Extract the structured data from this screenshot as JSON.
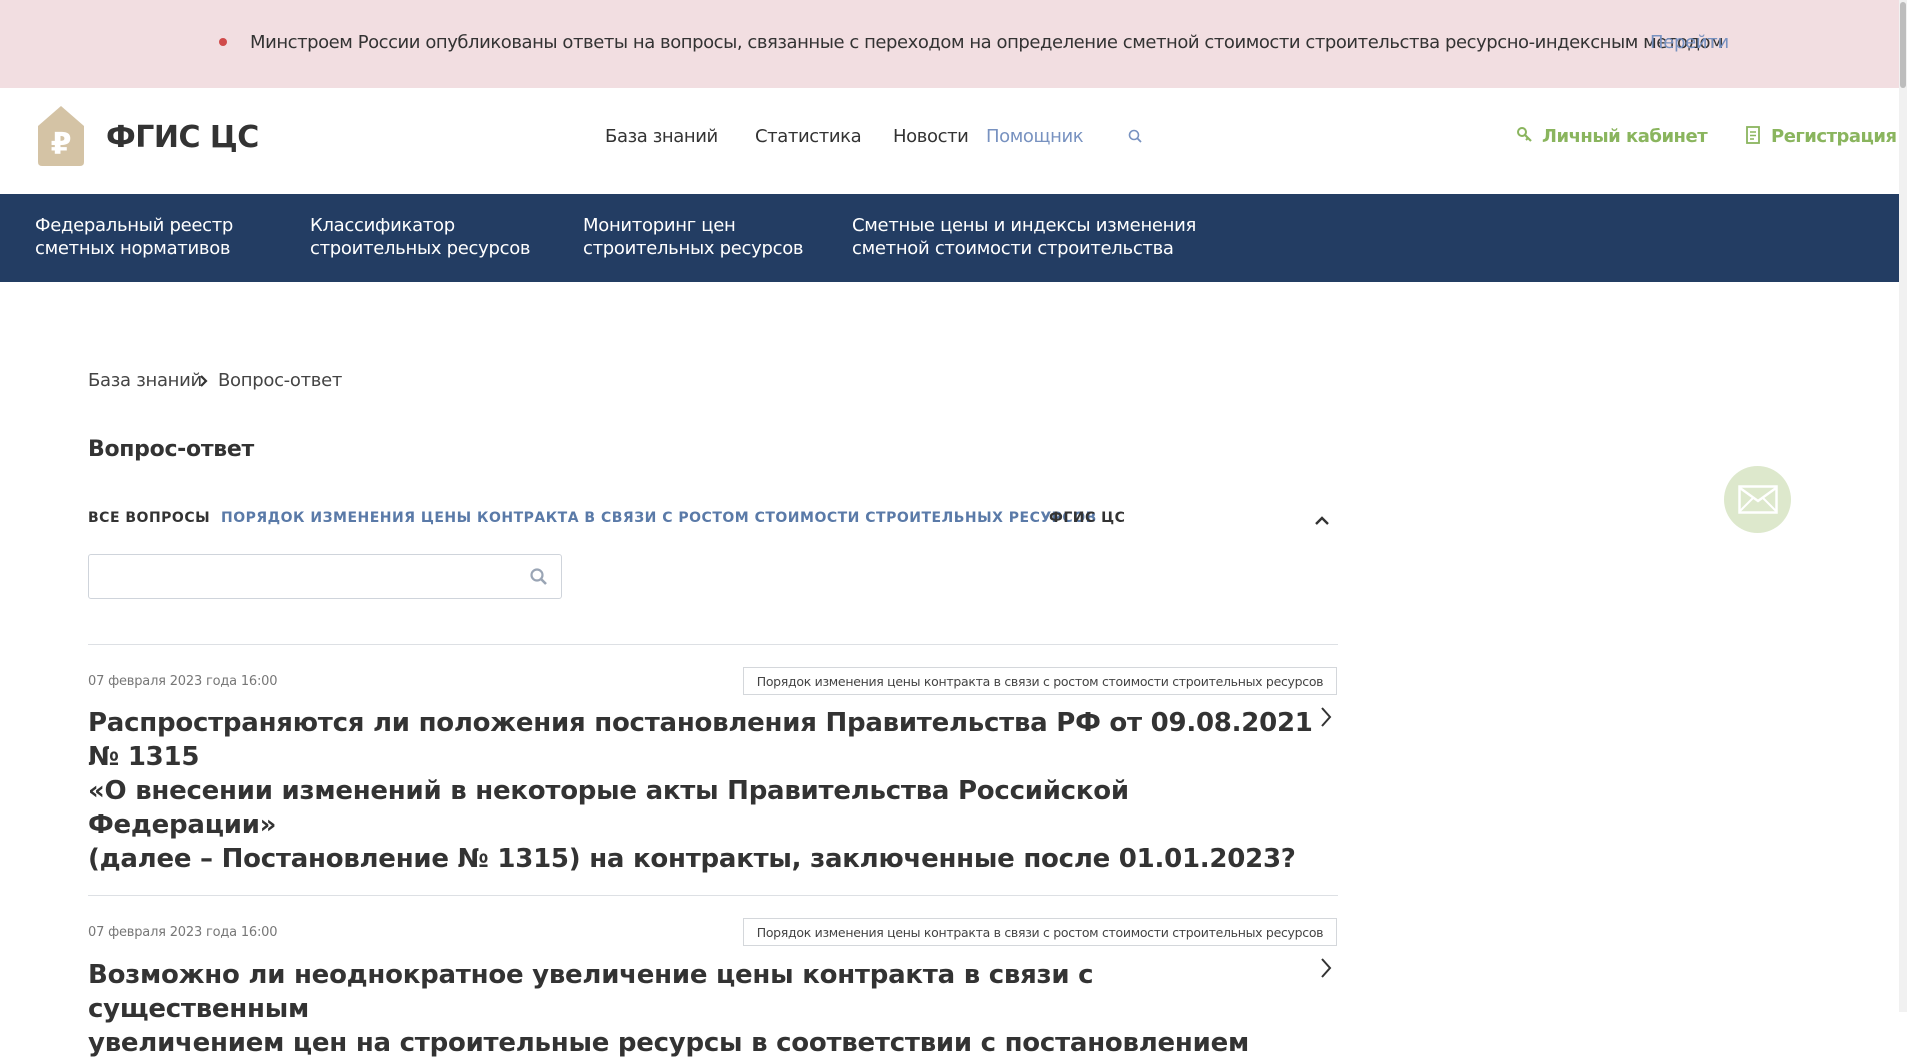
{
  "announcement": {
    "text": "Минстроем России опубликованы ответы на вопросы, связанные с переходом на определение сметной стоимости строительства ресурсно-индексным методом",
    "link_label": "Перейти"
  },
  "header": {
    "logo_text": "ФГИС ЦС",
    "nav": [
      "База знаний",
      "Статистика",
      "Новости",
      "Помощник"
    ],
    "account_label": "Личный кабинет",
    "register_label": "Регистрация"
  },
  "main_nav": [
    {
      "line1": "Федеральный реестр",
      "line2": "сметных нормативов"
    },
    {
      "line1": "Классификатор",
      "line2": "строительных ресурсов"
    },
    {
      "line1": "Мониторинг цен",
      "line2": "строительных ресурсов"
    },
    {
      "line1": "Сметные цены и индексы изменения",
      "line2": "сметной стоимости строительства"
    }
  ],
  "breadcrumb": [
    "База знаний",
    "Вопрос-ответ"
  ],
  "page_title": "Вопрос-ответ",
  "tabs": [
    {
      "label": "ВСЕ ВОПРОСЫ",
      "active": false
    },
    {
      "label": "ПОРЯДОК ИЗМЕНЕНИЯ ЦЕНЫ КОНТРАКТА В СВЯЗИ С РОСТОМ СТОИМОСТИ СТРОИТЕЛЬНЫХ РЕСУРСОВ",
      "active": true
    },
    {
      "label": "ФГИС ЦС",
      "active": false
    }
  ],
  "search": {
    "value": "",
    "placeholder": ""
  },
  "questions": [
    {
      "date": "07 февраля 2023 года 16:00",
      "tag": "Порядок изменения цены контракта в связи с ростом стоимости строительных ресурсов",
      "title_lines": [
        "Распространяются ли положения постановления Правительства РФ от 09.08.2021 № 1315",
        "«О внесении изменений в некоторые акты Правительства Российской Федерации»",
        "(далее – Постановление № 1315) на контракты, заключенные после 01.01.2023?"
      ]
    },
    {
      "date": "07 февраля 2023 года 16:00",
      "tag": "Порядок изменения цены контракта в связи с ростом стоимости строительных ресурсов",
      "title_lines": [
        "Возможно ли неоднократное увеличение цены контракта в связи с существенным",
        "увеличением цен на строительные ресурсы в соответствии с постановлением"
      ]
    }
  ],
  "colors": {
    "announce_bg": "#f2dee1",
    "nav_bg": "#233d63",
    "accent_green": "#8ab55e",
    "link_blue": "#7892c0",
    "logo_tan": "#d4c3a5"
  },
  "icons": [
    "ruble-logo-icon",
    "search-icon",
    "key-icon",
    "document-icon",
    "chevron-right-icon",
    "chevron-up-icon",
    "mail-icon"
  ]
}
